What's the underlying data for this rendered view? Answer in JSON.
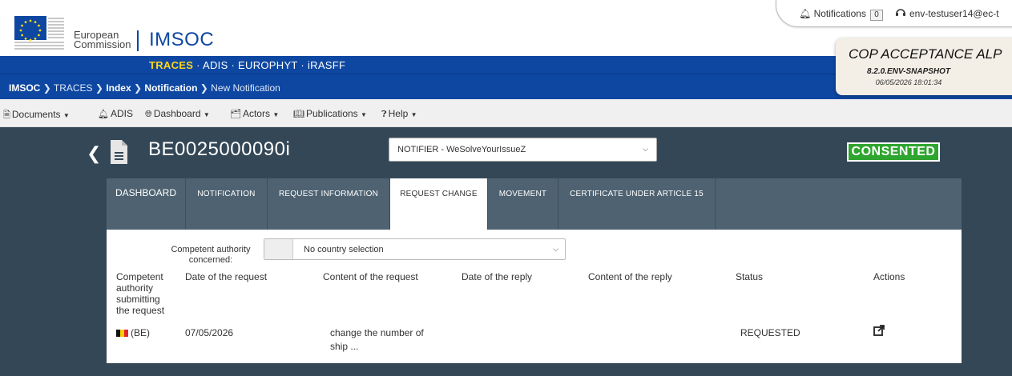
{
  "header": {
    "ec_line1": "European",
    "ec_line2": "Commission",
    "app_name": "IMSOC",
    "apps": [
      "TRACES",
      "ADIS",
      "EUROPHYT",
      "iRASFF"
    ],
    "active_app": "TRACES",
    "separator": "·"
  },
  "userbar": {
    "notifications_label": "Notifications",
    "notifications_count": "0",
    "user": "env-testuser14@ec-t"
  },
  "environment": {
    "title": "COP ACCEPTANCE ALP",
    "version": "8.2.0.ENV-SNAPSHOT",
    "datetime": "06/05/2026 18:01:34"
  },
  "breadcrumb": {
    "items": [
      "IMSOC",
      "TRACES",
      "Index",
      "Notification",
      "New Notification"
    ],
    "separator": ">"
  },
  "menu": {
    "documents": "Documents",
    "adis": "ADIS",
    "dashboard": "Dashboard",
    "actors": "Actors",
    "publications": "Publications",
    "help": "Help"
  },
  "document": {
    "number": "BE0025000090i",
    "notifier": "NOTIFIER - WeSolveYourIssueZ",
    "status": "CONSENTED"
  },
  "tabs": [
    {
      "label": "DASHBOARD",
      "style": "large"
    },
    {
      "label": "Notification",
      "style": "smallcaps"
    },
    {
      "label": "Request information",
      "style": "smallcaps"
    },
    {
      "label": "Request change",
      "style": "smallcaps",
      "active": true
    },
    {
      "label": "Movement",
      "style": "smallcaps"
    },
    {
      "label": "Certificate under Article 15",
      "style": "smallcaps"
    }
  ],
  "filter": {
    "label_line1": "Competent authority",
    "label_line2": "concerned:",
    "value": "No country selection"
  },
  "table": {
    "headers": {
      "authority": [
        "Competent",
        "authority",
        "submitting",
        "the request"
      ],
      "date_request": "Date of the request",
      "content_request": "Content of the request",
      "date_reply": "Date of the reply",
      "content_reply": "Content of the reply",
      "status": "Status",
      "actions": "Actions"
    },
    "rows": [
      {
        "authority": "(BE)",
        "date_request": "07/05/2026",
        "content_request_line1": "change the number of",
        "content_request_line2": "ship ...",
        "date_reply": "",
        "content_reply": "",
        "status": "REQUESTED"
      }
    ]
  },
  "colors": {
    "brand_blue": "#0e47a1",
    "traces_yellow": "#ffd617",
    "main_bg": "#344756",
    "tab_bg": "#4e6271",
    "consented_green": "#2ea52e"
  }
}
